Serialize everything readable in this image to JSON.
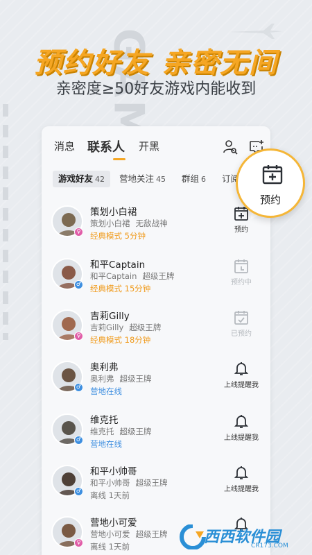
{
  "hero": {
    "title": "预约好友 亲密无间",
    "subtitle": "亲密度≥50好友游戏内能收到"
  },
  "topnav": {
    "tabs": [
      "消息",
      "联系人",
      "开黑"
    ],
    "active": "联系人"
  },
  "subtabs": [
    {
      "label": "游戏好友",
      "count": "42"
    },
    {
      "label": "营地关注",
      "count": "45"
    },
    {
      "label": "群组",
      "count": "6"
    },
    {
      "label": "订阅",
      "count": ""
    }
  ],
  "bubble": {
    "label": "预约",
    "icon": "calendar-add-icon"
  },
  "friends": [
    {
      "name": "策划小白裙",
      "nick": "策划小白裙",
      "title": "无敌战神",
      "status": "经典模式 5分钟",
      "status_color": "orange",
      "gender": "f",
      "action": "预约",
      "action_state": "active",
      "avatar_color": "#7c6a52"
    },
    {
      "name": "和平Captain",
      "nick": "和平Captain",
      "title": "超级王牌",
      "status": "经典模式 15分钟",
      "status_color": "orange",
      "gender": "m",
      "action": "预约中",
      "action_state": "dim",
      "avatar_color": "#8a5a48"
    },
    {
      "name": "吉莉Gilly",
      "nick": "吉莉Gilly",
      "title": "超级王牌",
      "status": "经典模式 18分钟",
      "status_color": "orange",
      "gender": "f",
      "action": "已预约",
      "action_state": "dim",
      "avatar_color": "#a0694f"
    },
    {
      "name": "奥利弗",
      "nick": "奥利弗",
      "title": "超级王牌",
      "status": "营地在线",
      "status_color": "blue",
      "gender": "m",
      "action": "上线提醒我",
      "action_state": "bell",
      "avatar_color": "#6b5544"
    },
    {
      "name": "维克托",
      "nick": "维克托",
      "title": "超级王牌",
      "status": "营地在线",
      "status_color": "blue",
      "gender": "m",
      "action": "上线提醒我",
      "action_state": "bell",
      "avatar_color": "#59544c"
    },
    {
      "name": "和平小帅哥",
      "nick": "和平小帅哥",
      "title": "超级王牌",
      "status": "离线 1天前",
      "status_color": "gray",
      "gender": "m",
      "action": "上线提醒我",
      "action_state": "bell",
      "avatar_color": "#4e4037"
    },
    {
      "name": "营地小可爱",
      "nick": "营地小可爱",
      "title": "超级王牌",
      "status": "离线 1天前",
      "status_color": "gray",
      "gender": "f",
      "action": "",
      "action_state": "bell",
      "avatar_color": "#7a5a44"
    }
  ],
  "background_text": "GAME FOR PEACE",
  "watermark": {
    "brand": "西西软件园",
    "url": "CR173.COM"
  }
}
